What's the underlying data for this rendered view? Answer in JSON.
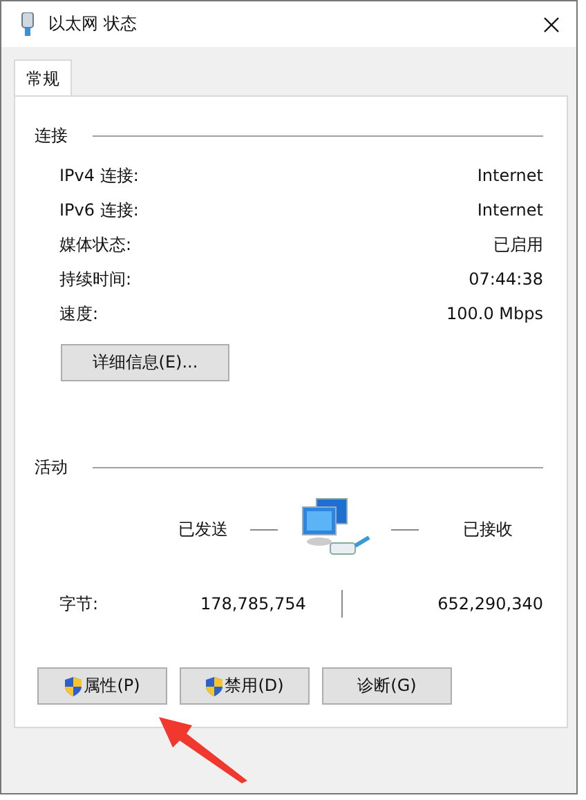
{
  "window": {
    "title": "以太网 状态"
  },
  "tabs": [
    {
      "label": "常规",
      "selected": true
    }
  ],
  "connection": {
    "heading": "连接",
    "rows": [
      {
        "label": "IPv4 连接:",
        "value": "Internet"
      },
      {
        "label": "IPv6 连接:",
        "value": "Internet"
      },
      {
        "label": "媒体状态:",
        "value": "已启用"
      },
      {
        "label": "持续时间:",
        "value": "07:44:38"
      },
      {
        "label": "速度:",
        "value": "100.0 Mbps"
      }
    ],
    "details_button": "详细信息(E)..."
  },
  "activity": {
    "heading": "活动",
    "sent_label": "已发送",
    "received_label": "已接收",
    "bytes_label": "字节:",
    "bytes_sent": "178,785,754",
    "bytes_received": "652,290,340"
  },
  "buttons": [
    {
      "label": "属性(P)",
      "shield": true
    },
    {
      "label": "禁用(D)",
      "shield": true
    },
    {
      "label": "诊断(G)",
      "shield": false
    }
  ]
}
